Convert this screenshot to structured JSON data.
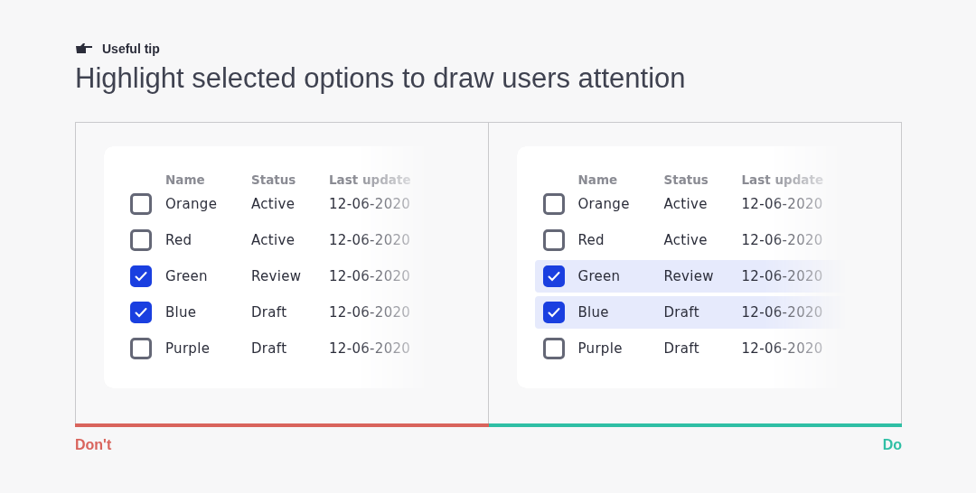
{
  "tip": {
    "label": "Useful tip"
  },
  "headline": "Highlight selected options to draw users attention",
  "panels": [
    {
      "kind": "dont",
      "highlight_selected": false,
      "verdict": "Don't",
      "color": "#d9645c",
      "columns": [
        "Name",
        "Status",
        "Last update"
      ],
      "rows": [
        {
          "name": "Orange",
          "status": "Active",
          "date": "12-06-2020",
          "selected": false
        },
        {
          "name": "Red",
          "status": "Active",
          "date": "12-06-2020",
          "selected": false
        },
        {
          "name": "Green",
          "status": "Review",
          "date": "12-06-2020",
          "selected": true
        },
        {
          "name": "Blue",
          "status": "Draft",
          "date": "12-06-2020",
          "selected": true
        },
        {
          "name": "Purple",
          "status": "Draft",
          "date": "12-06-2020",
          "selected": false
        }
      ]
    },
    {
      "kind": "do",
      "highlight_selected": true,
      "verdict": "Do",
      "color": "#2fbfa5",
      "columns": [
        "Name",
        "Status",
        "Last update"
      ],
      "rows": [
        {
          "name": "Orange",
          "status": "Active",
          "date": "12-06-2020",
          "selected": false
        },
        {
          "name": "Red",
          "status": "Active",
          "date": "12-06-2020",
          "selected": false
        },
        {
          "name": "Green",
          "status": "Review",
          "date": "12-06-2020",
          "selected": true
        },
        {
          "name": "Blue",
          "status": "Draft",
          "date": "12-06-2020",
          "selected": true
        },
        {
          "name": "Purple",
          "status": "Draft",
          "date": "12-06-2020",
          "selected": false
        }
      ]
    }
  ]
}
